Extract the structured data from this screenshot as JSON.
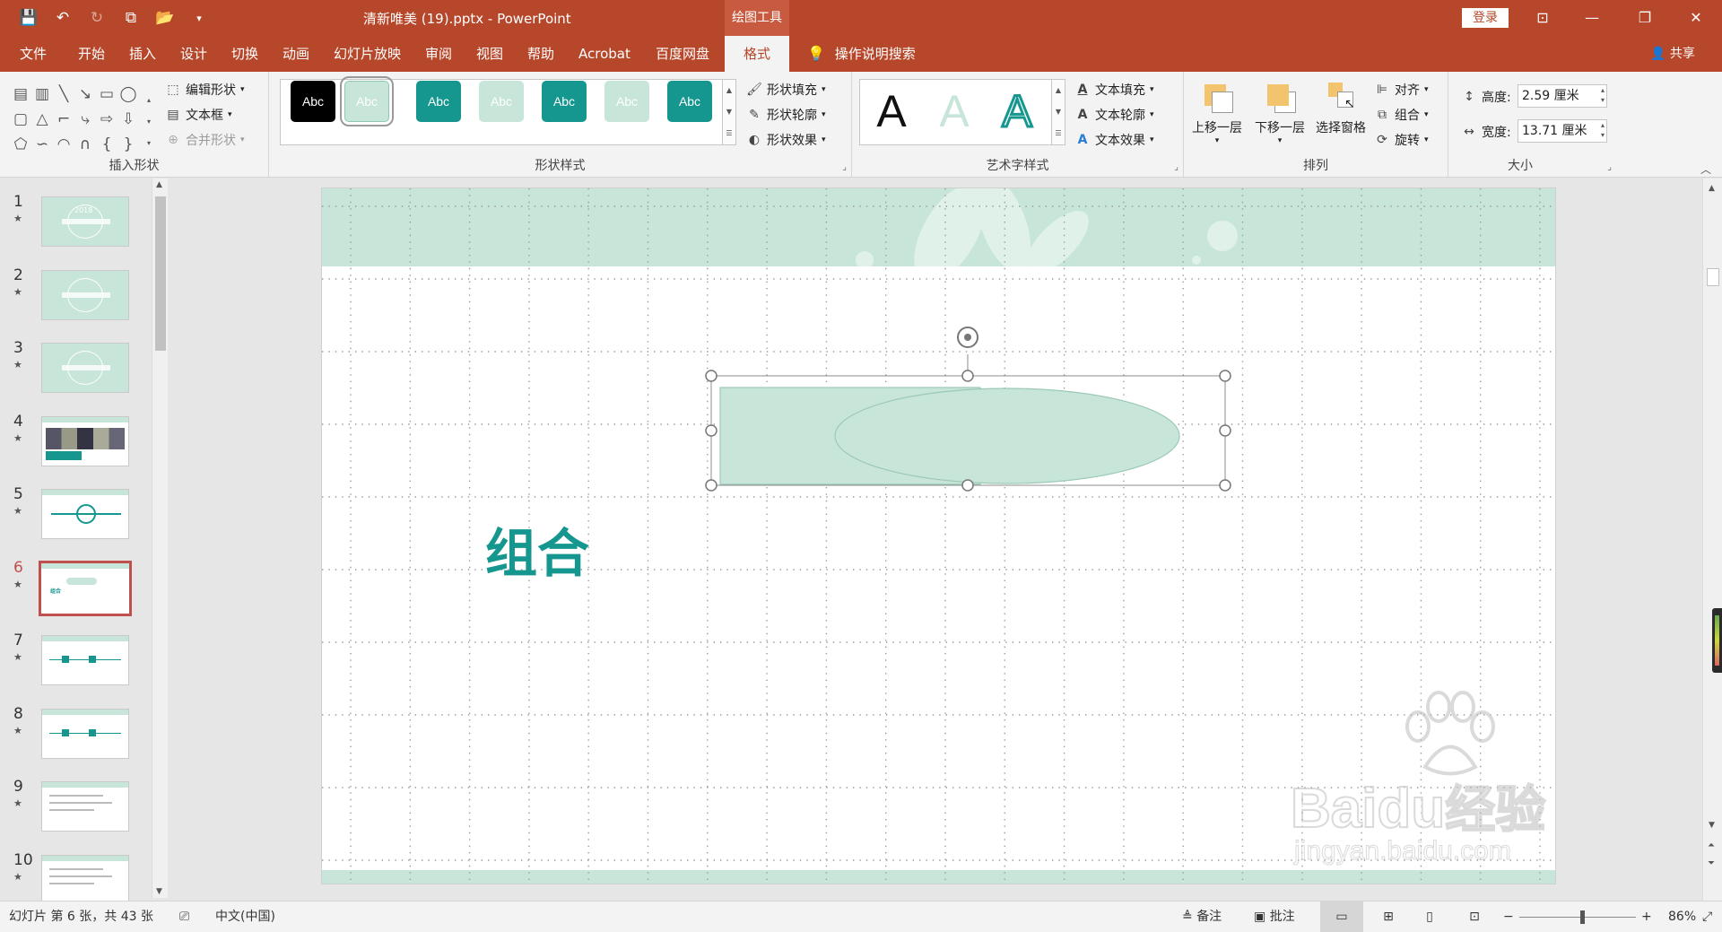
{
  "window": {
    "title": "清新唯美 (19).pptx  -  PowerPoint",
    "context_tab": "绘图工具",
    "login": "登录",
    "buttons": {
      "minimize": "—",
      "restore": "❐",
      "close": "✕",
      "ribbon_options": "⊡"
    }
  },
  "quick_access": [
    "save-icon",
    "undo-icon",
    "redo-icon",
    "present-icon",
    "open-icon",
    "customize-icon"
  ],
  "tabs": {
    "file": "文件",
    "home": "开始",
    "insert": "插入",
    "design": "设计",
    "transitions": "切换",
    "animations": "动画",
    "slideshow": "幻灯片放映",
    "review": "审阅",
    "view": "视图",
    "help": "帮助",
    "acrobat": "Acrobat",
    "baidu": "百度网盘",
    "format": "格式"
  },
  "search_hint": "操作说明搜索",
  "share": "共享",
  "ribbon": {
    "insert_shapes": {
      "label": "插入形状",
      "edit_shape": "编辑形状",
      "text_box": "文本框",
      "merge_shapes": "合并形状"
    },
    "shape_styles": {
      "label": "形状样式",
      "styles": [
        {
          "text": "Abc",
          "bg": "#000000",
          "fg": "#ffffff",
          "border": "#000000"
        },
        {
          "text": "Abc",
          "bg": "#c7e6d9",
          "fg": "#ffffff",
          "border": "#8fc7b0"
        },
        {
          "text": "Abc",
          "bg": "#15968f",
          "fg": "#ffffff",
          "border": "#15968f"
        },
        {
          "text": "Abc",
          "bg": "#c7e6d9",
          "fg": "#ffffff",
          "border": "#c7e6d9"
        },
        {
          "text": "Abc",
          "bg": "#15968f",
          "fg": "#ffffff",
          "border": "#15968f"
        },
        {
          "text": "Abc",
          "bg": "#c7e6d9",
          "fg": "#ffffff",
          "border": "#c7e6d9"
        },
        {
          "text": "Abc",
          "bg": "#15968f",
          "fg": "#ffffff",
          "border": "#15968f"
        }
      ],
      "fill": "形状填充",
      "outline": "形状轮廓",
      "effects": "形状效果"
    },
    "wordart": {
      "label": "艺术字样式",
      "samples": [
        "A",
        "A",
        "A"
      ],
      "text_fill": "文本填充",
      "text_outline": "文本轮廓",
      "text_effects": "文本效果"
    },
    "arrange": {
      "label": "排列",
      "bring_forward": "上移一层",
      "send_backward": "下移一层",
      "selection_pane": "选择窗格",
      "align": "对齐",
      "group": "组合",
      "rotate": "旋转"
    },
    "size": {
      "label": "大小",
      "height_label": "高度:",
      "height_value": "2.59 厘米",
      "width_label": "宽度:",
      "width_value": "13.71 厘米"
    }
  },
  "thumbnails": {
    "selected": 6,
    "items": [
      {
        "num": "1",
        "star": "★",
        "kind": "cover",
        "text": "2018"
      },
      {
        "num": "2",
        "star": "★",
        "kind": "cover",
        "text": ""
      },
      {
        "num": "3",
        "star": "★",
        "kind": "cover",
        "text": ""
      },
      {
        "num": "4",
        "star": "★",
        "kind": "photo",
        "text": ""
      },
      {
        "num": "5",
        "star": "★",
        "kind": "diagram",
        "text": ""
      },
      {
        "num": "6",
        "star": "★",
        "kind": "current",
        "text": "组合"
      },
      {
        "num": "7",
        "star": "★",
        "kind": "flow",
        "text": ""
      },
      {
        "num": "8",
        "star": "★",
        "kind": "flow",
        "text": ""
      },
      {
        "num": "9",
        "star": "★",
        "kind": "list",
        "text": ""
      },
      {
        "num": "10",
        "star": "★",
        "kind": "text",
        "text": ""
      }
    ]
  },
  "slide": {
    "title": "组合",
    "title_color": "#15968f",
    "band_color": "#c7e6d9",
    "shape_fill": "#c7e6d9",
    "shape_stroke": "#9cc9b6"
  },
  "watermark": {
    "brand": "Bai",
    "brand2": "du",
    "cn": "经验",
    "url": "jingyan.baidu.com"
  },
  "status": {
    "slide_info": "幻灯片 第 6 张，共 43 张",
    "language": "中文(中国)",
    "notes": "备注",
    "comments": "批注",
    "zoom": "86%",
    "zoom_level": 0.54
  },
  "colors": {
    "accent": "#b7472a",
    "context_tab": "#c85b3f"
  }
}
